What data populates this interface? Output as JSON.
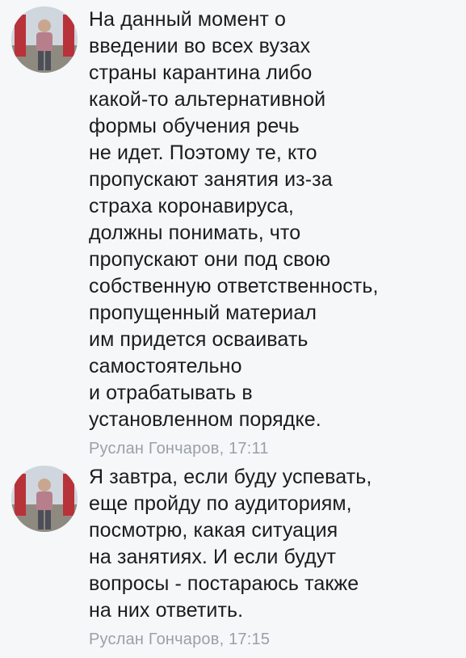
{
  "messages": [
    {
      "text": "На данный момент о\nвведении во всех вузах\nстраны карантина либо\nкакой-то альтернативной\nформы обучения речь\nне идет. Поэтому те, кто\nпропускают занятия из-за\nстраха коронавируса,\nдолжны понимать, что\nпропускают они под свою\nсобственную ответственность,\nпропущенный материал\nим придется осваивать\nсамостоятельно\nи отрабатывать в\nустановленном порядке.",
      "author": "Руслан Гончаров",
      "time": "17:11",
      "meta": "Руслан Гончаров, 17:11",
      "avatar_icon": "user-avatar-photo"
    },
    {
      "text": "Я завтра, если буду успевать,\nеще пройду по аудиториям,\nпосмотрю, какая ситуация\nна занятиях. И если будут\nвопросы - постараюсь также\nна них ответить.",
      "author": "Руслан Гончаров",
      "time": "17:15",
      "meta": "Руслан Гончаров, 17:15",
      "avatar_icon": "user-avatar-photo"
    }
  ],
  "colors": {
    "background": "#f6f7f9",
    "text": "#1c1c1c",
    "meta": "#9aa0a8"
  }
}
